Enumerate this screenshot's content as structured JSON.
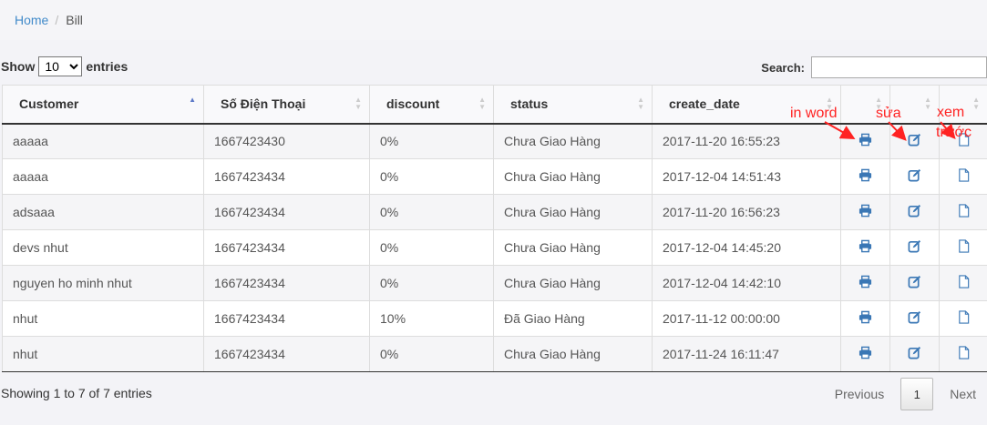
{
  "breadcrumb": {
    "home": "Home",
    "separator": "/",
    "current": "Bill"
  },
  "length": {
    "show_label": "Show",
    "selected": "10",
    "entries_label": "entries"
  },
  "search": {
    "label": "Search:",
    "value": "",
    "placeholder": ""
  },
  "table": {
    "headers": [
      "Customer",
      "Số Điện Thoại",
      "discount",
      "status",
      "create_date",
      "",
      "",
      ""
    ],
    "sorted_column": 0,
    "rows": [
      {
        "customer": "aaaaa",
        "phone": "1667423430",
        "discount": "0%",
        "status": "Chưa Giao Hàng",
        "create_date": "2017-11-20 16:55:23"
      },
      {
        "customer": "aaaaa",
        "phone": "1667423434",
        "discount": "0%",
        "status": "Chưa Giao Hàng",
        "create_date": "2017-12-04 14:51:43"
      },
      {
        "customer": "adsaaa",
        "phone": "1667423434",
        "discount": "0%",
        "status": "Chưa Giao Hàng",
        "create_date": "2017-11-20 16:56:23"
      },
      {
        "customer": "devs nhut",
        "phone": "1667423434",
        "discount": "0%",
        "status": "Chưa Giao Hàng",
        "create_date": "2017-12-04 14:45:20"
      },
      {
        "customer": "nguyen ho minh nhut",
        "phone": "1667423434",
        "discount": "0%",
        "status": "Chưa Giao Hàng",
        "create_date": "2017-12-04 14:42:10"
      },
      {
        "customer": "nhut",
        "phone": "1667423434",
        "discount": "10%",
        "status": "Đã Giao Hàng",
        "create_date": "2017-11-12 00:00:00"
      },
      {
        "customer": "nhut",
        "phone": "1667423434",
        "discount": "0%",
        "status": "Chưa Giao Hàng",
        "create_date": "2017-11-24 16:11:47"
      }
    ],
    "row_icons": [
      "printer-icon",
      "edit-icon",
      "file-icon"
    ]
  },
  "annotations": {
    "print_word": "in word",
    "edit": "sửa",
    "preview_line1": "xem",
    "preview_line2": "trước"
  },
  "footer": {
    "info": "Showing 1 to 7 of 7 entries",
    "previous": "Previous",
    "page": "1",
    "next": "Next"
  },
  "colors": {
    "link": "#428bca",
    "icon": "#3a77b5",
    "annotation": "#ff2222",
    "sort_active": "#5b78c7"
  }
}
